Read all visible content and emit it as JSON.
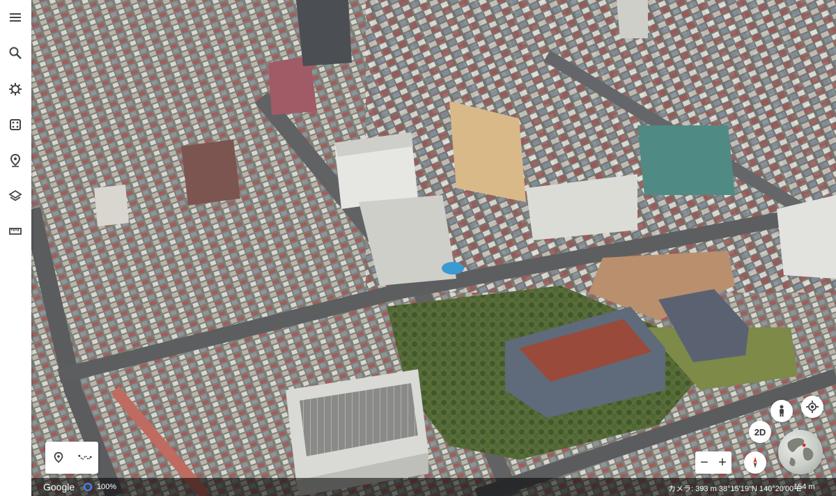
{
  "sidebar": {
    "items": [
      {
        "name": "menu",
        "icon": "menu-icon"
      },
      {
        "name": "search",
        "icon": "search-icon"
      },
      {
        "name": "voyager",
        "icon": "voyager-helm-icon"
      },
      {
        "name": "feeling-lucky",
        "icon": "dice-icon"
      },
      {
        "name": "projects",
        "icon": "map-pin-icon"
      },
      {
        "name": "map-style",
        "icon": "layers-icon"
      },
      {
        "name": "measure",
        "icon": "ruler-icon"
      }
    ]
  },
  "tools": {
    "placemark_icon": "map-pin-icon",
    "path_icon": "path-line-icon"
  },
  "controls": {
    "pegman_icon": "pegman-icon",
    "location_icon": "my-location-icon",
    "view_mode_label": "2D",
    "zoom_out_label": "−",
    "zoom_in_label": "+",
    "compass_icon": "compass-icon",
    "globe_icon": "globe-icon"
  },
  "status": {
    "brand": "Google",
    "progress_label": "100%",
    "progress": 1.0,
    "camera": "カメラ: 393 m 38°15'19\"N 140°20'00\"E",
    "scale": "154 m"
  },
  "colors": {
    "accent": "#4285f4",
    "compass_red": "#d93025"
  }
}
